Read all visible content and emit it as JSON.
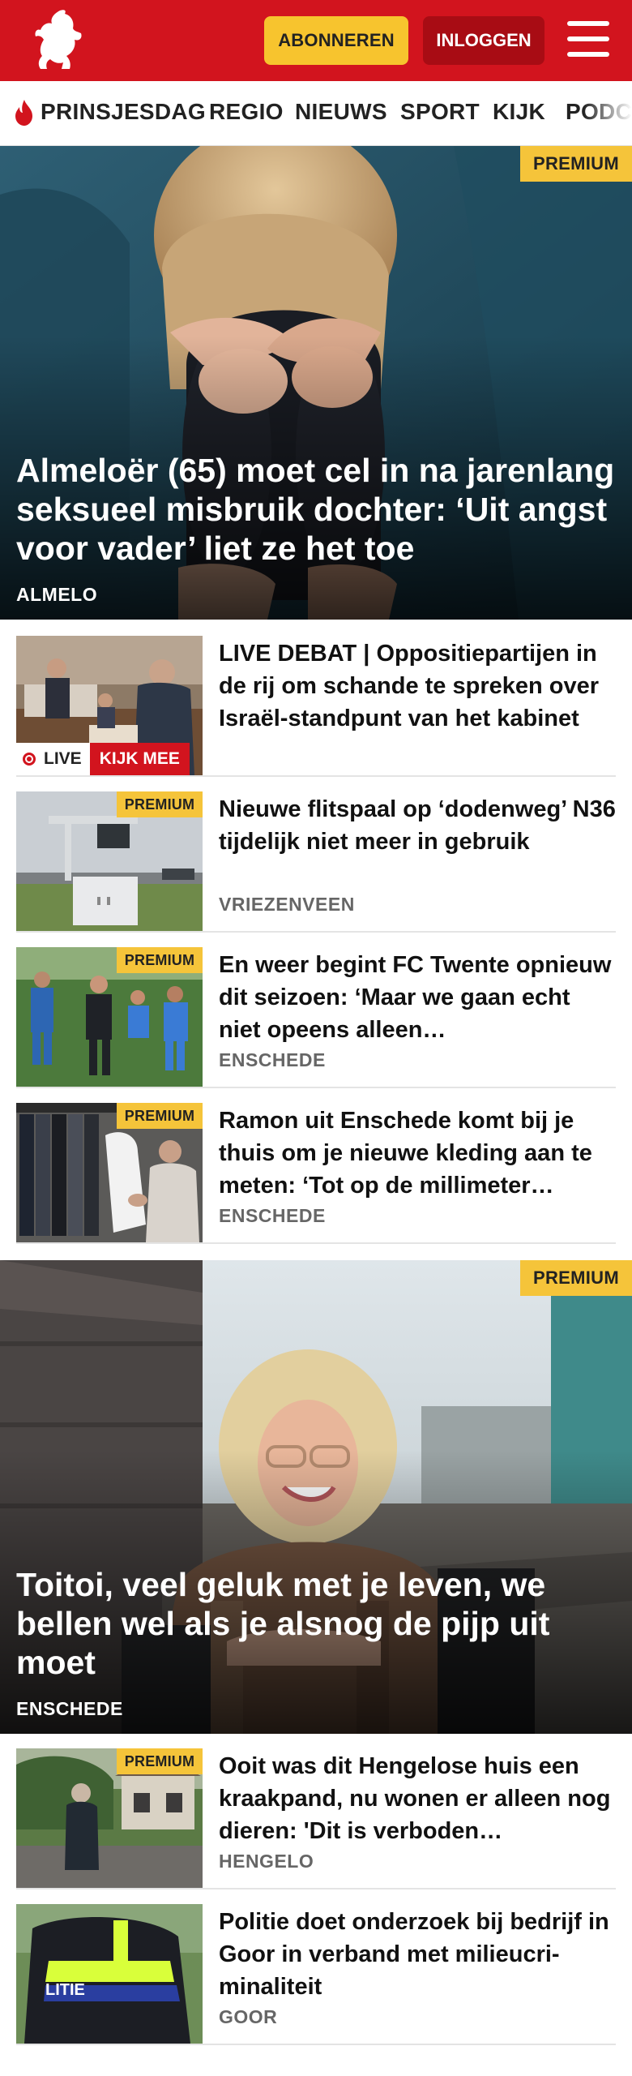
{
  "header": {
    "logo_icon": "tubantia-horse-icon",
    "subscribe_label": "ABONNEREN",
    "login_label": "INLOGGEN",
    "menu_icon": "hamburger-menu-icon",
    "brand_color": "#d2141e",
    "accent_color": "#f7c42e"
  },
  "nav": {
    "items": [
      {
        "label": "PRINSJESDAG",
        "icon": "flame-icon"
      },
      {
        "label": "REGIO"
      },
      {
        "label": "NIEUWS"
      },
      {
        "label": "SPORT"
      },
      {
        "label": "KIJK"
      },
      {
        "label": "PODCA"
      }
    ]
  },
  "hero1": {
    "badge": "PREMIUM",
    "title": "Almeloër (65) moet cel in na jarenlang seksueel misbruik dochter: ‘Uit angst voor vader’ liet ze het toe",
    "location": "ALMELO"
  },
  "articles": [
    {
      "title": "LIVE DEBAT | Oppositiepartijen in de rij om schande te spreken over Israël-standpunt van het kabinet",
      "live_label": "LIVE",
      "watch_label": "KIJK MEE"
    },
    {
      "badge": "PREMIUM",
      "title": "Nieuwe flitspaal op ‘dodenweg’ N36 tijdelijk niet meer in gebruik",
      "location": "VRIEZENVEEN"
    },
    {
      "badge": "PREMIUM",
      "title": "En weer begint FC Twente opnieuw dit seizoen: ‘Maar we gaan echt niet opeens alleen…",
      "location": "ENSCHEDE"
    },
    {
      "badge": "PREMIUM",
      "title": "Ramon uit Enschede komt bij je thuis om je nieuwe kleding aan te meten: ‘Tot op de millimeter…",
      "location": "ENSCHEDE"
    }
  ],
  "hero2": {
    "badge": "PREMIUM",
    "title": "Toitoi, veel geluk met je leven, we bellen wel als je alsnog de pijp uit moet",
    "location": "ENSCHEDE"
  },
  "articles2": [
    {
      "badge": "PREMIUM",
      "title": "Ooit was dit Hengelose huis een kraakpand, nu wonen er alleen nog dieren: 'Dit is verboden…",
      "location": "HENGELO"
    },
    {
      "title": "Politie doet onderzoek bij bedrijf in Goor in verband met milieucri-minaliteit",
      "location": "GOOR",
      "thumb_text": "LITIE"
    }
  ]
}
